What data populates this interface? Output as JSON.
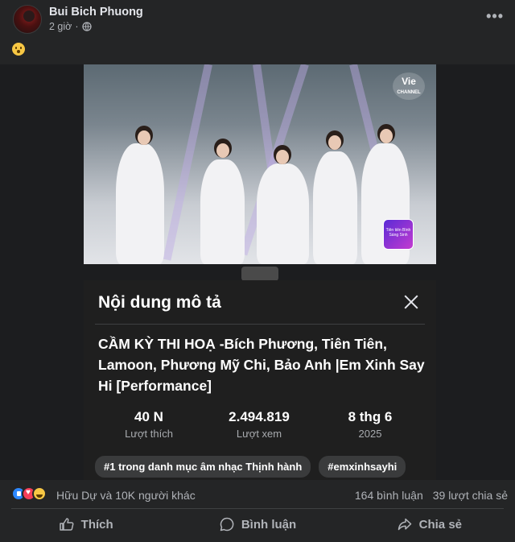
{
  "post": {
    "author": "Bui Bich Phuong",
    "time": "2 giờ",
    "separator": "·",
    "visibility_icon": "globe-icon",
    "caption_emoji": "flushed-face-emoji"
  },
  "video": {
    "channel_logo_line1": "Vie",
    "channel_logo_line2": "CHANNEL",
    "thumbnail_badge_text": "Tiên tiên Bình Sáng Sinh"
  },
  "description_sheet": {
    "heading": "Nội dung mô tả",
    "title": "CẦM KỲ THI HOẠ -Bích Phương, Tiên Tiên, Lamoon, Phương Mỹ Chi, Bảo Anh |Em Xinh Say Hi [Performance]",
    "stats": [
      {
        "value": "40 N",
        "label": "Lượt thích"
      },
      {
        "value": "2.494.819",
        "label": "Lượt xem"
      },
      {
        "value": "8 thg 6",
        "label": "2025"
      }
    ],
    "chips": [
      "#1 trong danh mục âm nhạc Thịnh hành",
      "#emxinhsayhi"
    ]
  },
  "reactions": {
    "icons": [
      "like",
      "love",
      "haha"
    ],
    "summary": "Hữu Dự và 10K người khác",
    "comments": "164 bình luận",
    "shares": "39 lượt chia sẻ"
  },
  "actions": {
    "like": "Thích",
    "comment": "Bình luận",
    "share": "Chia sẻ"
  }
}
